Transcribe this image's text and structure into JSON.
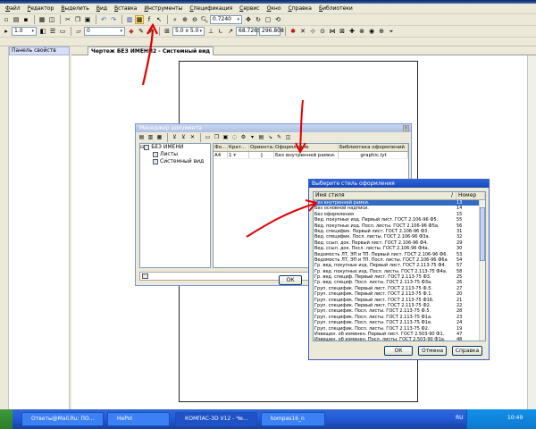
{
  "menu": [
    "Файл",
    "Редактор",
    "Выделить",
    "Вид",
    "Вставка",
    "Инструменты",
    "Спецификация",
    "Сервис",
    "Окно",
    "Справка",
    "Библиотеки"
  ],
  "toolbar": {
    "zoom_value": "0.7240",
    "line_width": "1.0",
    "layer": "0",
    "scale": "5.0 x 5.0",
    "coord_x": "68.7265",
    "coord_y": "296.808"
  },
  "panel": {
    "title": "Панель свойств"
  },
  "doc_tab": {
    "label": "Чертеж БЕЗ ИМЕНИ2 - Системный вид"
  },
  "dialog1": {
    "title": "Менеджер документа",
    "tree": {
      "root": "БЕЗ ИМЕНИ",
      "items": [
        "Листы",
        "Системный вид"
      ]
    },
    "columns": [
      "Фо...",
      "Крат...",
      "Ориента...",
      "Оформление",
      "Библиотека оформлений"
    ],
    "rows": [
      {
        "format": "A4",
        "mult": "1",
        "orient": "",
        "style": "Без внутренней рамки.",
        "library": "graphic.lyt"
      }
    ],
    "ok": "ОК"
  },
  "dialog2": {
    "title": "Выберите стиль оформления",
    "col_name": "Имя стиля",
    "col_sort": "/",
    "col_num": "Номер",
    "rows": [
      {
        "name": "Без внутренней рамки.",
        "num": "13",
        "selected": true
      },
      {
        "name": "Без основной надписи.",
        "num": "14"
      },
      {
        "name": "Без оформления",
        "num": "15"
      },
      {
        "name": "Вед. покупных изд. Первый лист. ГОСТ 2.106-96 Ф5.",
        "num": "55"
      },
      {
        "name": "Вед. покупных изд. Посл. листы. ГОСТ 2.106-96 Ф5а.",
        "num": "56"
      },
      {
        "name": "Вед. специфик. Первый лист. ГОСТ 2.106-96 Ф3.",
        "num": "31"
      },
      {
        "name": "Вед. специфик. Посл. листы. ГОСТ 2.106-96 Ф3а.",
        "num": "32"
      },
      {
        "name": "Вед. ссыл. док. Первый лист. ГОСТ 2.106-96 Ф4.",
        "num": "29"
      },
      {
        "name": "Вед. ссыл. док. Посл. листы. ГОСТ 2.106-96 Ф4а.",
        "num": "30"
      },
      {
        "name": "Ведомость ЛТ, ЭП и ТП. Первый лист. ГОСТ 2.106-96 Ф6.",
        "num": "53"
      },
      {
        "name": "Ведомость ЛТ, ЭП и ТП. Посл. листы. ГОСТ 2.106-96 Ф6а.",
        "num": "54"
      },
      {
        "name": "Гр. вед. покупных изд. Первый лист. ГОСТ 2.113-75 Ф4.",
        "num": "57"
      },
      {
        "name": "Гр. вед. покупных изд. Посл. листы. ГОСТ 2.113-75 Ф4а.",
        "num": "58"
      },
      {
        "name": "Гр. вед. специф. Первый лист. ГОСТ 2.113-75 Ф3.",
        "num": "25"
      },
      {
        "name": "Гр. вед. специф. Посл. листы. ГОСТ 2.113-75 Ф3а.",
        "num": "26"
      },
      {
        "name": "Груп. специфик. Первый лист. ГОСТ 2.113-75 Ф.5.",
        "num": "27"
      },
      {
        "name": "Груп. специфик. Первый лист. ГОСТ 2.113-75 Ф.1.",
        "num": "20"
      },
      {
        "name": "Груп. специфик. Первый лист. ГОСТ 2.113-75 Ф1б.",
        "num": "21"
      },
      {
        "name": "Груп. специфик. Первый лист. ГОСТ 2.113-75 Ф2.",
        "num": "22"
      },
      {
        "name": "Груп. специфик. Посл. листы. ГОСТ 2.113-75 Ф.5.",
        "num": "28"
      },
      {
        "name": "Груп. специфик. Посл. листы. ГОСТ 2.113-75 Ф1а.",
        "num": "23"
      },
      {
        "name": "Груп. специфик. Посл. листы. ГОСТ 2.113-75 Ф1в.",
        "num": "24"
      },
      {
        "name": "Груп. специфик. Посл. листы. ГОСТ 2.113-75 Ф2.",
        "num": "19"
      },
      {
        "name": "Извещен. об изменен. Первый лист. ГОСТ 2.503-90 Ф1.",
        "num": "47"
      },
      {
        "name": "Извещен. об изменен. Посл. листы. ГОСТ 2.503-90 Ф1а.",
        "num": "48"
      }
    ],
    "ok": "ОК",
    "cancel": "Отмена",
    "help": "Справка"
  },
  "taskbar": {
    "tasks": [
      "Ответы@Mail.Ru: ПО...",
      "HePol",
      "КОМПАС-3D V12 - Че...",
      "kompas16_n"
    ],
    "lang": "RU",
    "clock": "10:49"
  },
  "colors": {
    "annotation": "#e00000",
    "selection": "#316ac5"
  }
}
